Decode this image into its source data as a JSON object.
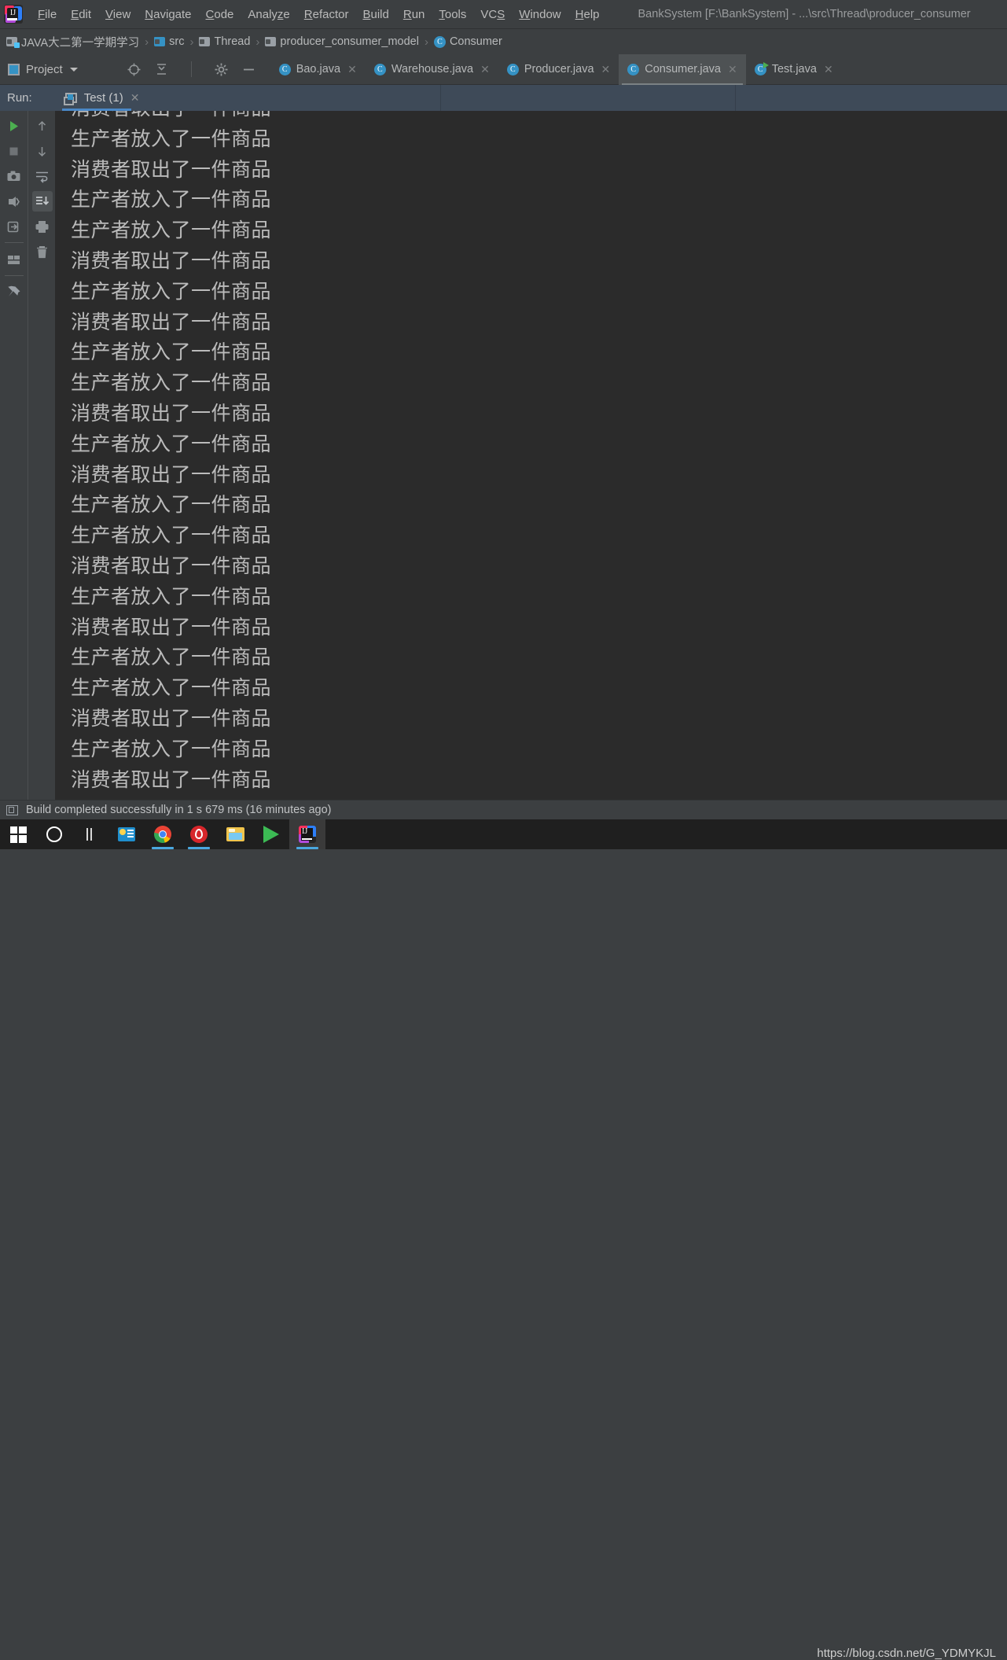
{
  "window": {
    "title": "BankSystem [F:\\BankSystem] - ...\\src\\Thread\\producer_consumer"
  },
  "menubar": {
    "items": [
      {
        "label": "File",
        "mnemonic": "F"
      },
      {
        "label": "Edit",
        "mnemonic": "E"
      },
      {
        "label": "View",
        "mnemonic": "V"
      },
      {
        "label": "Navigate",
        "mnemonic": "N"
      },
      {
        "label": "Code",
        "mnemonic": "C"
      },
      {
        "label": "Analyze",
        "mnemonic": "z"
      },
      {
        "label": "Refactor",
        "mnemonic": "R"
      },
      {
        "label": "Build",
        "mnemonic": "B"
      },
      {
        "label": "Run",
        "mnemonic": "R"
      },
      {
        "label": "Tools",
        "mnemonic": "T"
      },
      {
        "label": "VCS",
        "mnemonic": "S"
      },
      {
        "label": "Window",
        "mnemonic": "W"
      },
      {
        "label": "Help",
        "mnemonic": "H"
      }
    ]
  },
  "breadcrumb": {
    "separator": "›",
    "items": [
      {
        "label": "JAVA大二第一学期学习",
        "icon": "project-folder-icon"
      },
      {
        "label": "src",
        "icon": "source-folder-icon"
      },
      {
        "label": "Thread",
        "icon": "package-folder-icon"
      },
      {
        "label": "producer_consumer_model",
        "icon": "package-folder-icon"
      },
      {
        "label": "Consumer",
        "icon": "java-class-icon"
      }
    ]
  },
  "toolbar": {
    "project_label": "Project",
    "icons": [
      "locate-target-icon",
      "collapse-all-icon",
      "settings-gear-icon",
      "minimize-icon"
    ]
  },
  "editor_tabs": [
    {
      "label": "Bao.java",
      "icon": "java-class-icon",
      "active": false,
      "close": "✕"
    },
    {
      "label": "Warehouse.java",
      "icon": "java-class-icon",
      "active": false,
      "close": "✕"
    },
    {
      "label": "Producer.java",
      "icon": "java-class-icon",
      "active": false,
      "close": "✕"
    },
    {
      "label": "Consumer.java",
      "icon": "java-class-icon",
      "active": true,
      "close": "✕"
    },
    {
      "label": "Test.java",
      "icon": "java-class-runnable-icon",
      "active": false,
      "close": "✕"
    }
  ],
  "run_panel": {
    "label": "Run:",
    "tab": {
      "label": "Test (1)",
      "close": "✕",
      "icon": "run-configuration-icon"
    },
    "accent_color": "#4a88c7",
    "header_bg": "#3e4a58",
    "left_toolbar": [
      {
        "name": "rerun-run-icon",
        "title": "Rerun"
      },
      {
        "name": "stop-icon",
        "title": "Stop"
      },
      {
        "name": "camera-snapshot-icon",
        "title": "Dump Threads"
      },
      {
        "name": "debug-resume-icon",
        "title": "Resume"
      },
      {
        "name": "step-into-icon",
        "title": "Step"
      },
      {
        "name": "layout-icon",
        "title": "Layout"
      },
      {
        "name": "pin-tab-icon",
        "title": "Pin Tab"
      }
    ],
    "right_toolbar": [
      {
        "name": "arrow-up-icon",
        "title": "Up the Stack Trace"
      },
      {
        "name": "arrow-down-icon",
        "title": "Down the Stack Trace"
      },
      {
        "name": "soft-wrap-icon",
        "title": "Soft-Wrap"
      },
      {
        "name": "scroll-to-end-icon",
        "title": "Scroll to End",
        "selected": true
      },
      {
        "name": "print-icon",
        "title": "Print"
      },
      {
        "name": "trash-icon",
        "title": "Clear All"
      }
    ]
  },
  "console": {
    "background": "#2b2b2b",
    "text_color": "#bbbbbb",
    "lines": [
      "消费者取出了一件商品",
      "生产者放入了一件商品",
      "消费者取出了一件商品",
      "生产者放入了一件商品",
      "生产者放入了一件商品",
      "消费者取出了一件商品",
      "生产者放入了一件商品",
      "消费者取出了一件商品",
      "生产者放入了一件商品",
      "生产者放入了一件商品",
      "消费者取出了一件商品",
      "生产者放入了一件商品",
      "消费者取出了一件商品",
      "生产者放入了一件商品",
      "生产者放入了一件商品",
      "消费者取出了一件商品",
      "生产者放入了一件商品",
      "消费者取出了一件商品",
      "生产者放入了一件商品",
      "生产者放入了一件商品",
      "消费者取出了一件商品",
      "生产者放入了一件商品",
      "消费者取出了一件商品"
    ]
  },
  "statusbar": {
    "message": "Build completed successfully in 1 s 679 ms (16 minutes ago)"
  },
  "taskbar": {
    "items": [
      {
        "name": "start-button-icon",
        "label": "Start"
      },
      {
        "name": "cortana-search-icon",
        "label": "Cortana"
      },
      {
        "name": "task-view-icon",
        "label": "Task View"
      },
      {
        "name": "wechat-work-icon",
        "label": "WeChat"
      },
      {
        "name": "chrome-icon",
        "label": "Google Chrome",
        "running": true
      },
      {
        "name": "netease-music-icon",
        "label": "NetEase Cloud Music",
        "running": true
      },
      {
        "name": "file-explorer-icon",
        "label": "File Explorer"
      },
      {
        "name": "media-player-icon",
        "label": "Media Player"
      },
      {
        "name": "intellij-idea-icon",
        "label": "IntelliJ IDEA",
        "running": true,
        "active": true
      }
    ],
    "watermark": "https://blog.csdn.net/G_YDMYKJL"
  }
}
